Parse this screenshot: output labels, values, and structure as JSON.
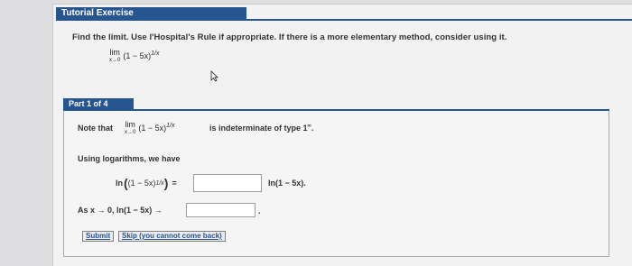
{
  "header": {
    "title": "Tutorial Exercise"
  },
  "question": {
    "text": "Find the limit. Use l'Hospital's Rule if appropriate. If there is a more elementary method, consider using it.",
    "lim_word": "lim",
    "lim_sub": "x→0",
    "expr_base": "(1 − 5x)",
    "expr_exp": "1/x"
  },
  "part": {
    "label": "Part 1 of 4",
    "note_prefix": "Note that",
    "note_suffix": "is indeterminate of type 1",
    "note_sup": "∞",
    "note_period": ".",
    "log_intro": "Using logarithms, we have",
    "ln_prefix": "ln",
    "ln_base": "(1 − 5x)",
    "ln_exp": "1/x",
    "equals": "=",
    "ln_right": "ln(1 − 5x).",
    "as_text": "As x → 0,  ln(1 − 5x) →",
    "as_period": "."
  },
  "buttons": {
    "submit": "Submit",
    "skip": "Skip (you cannot come back)"
  },
  "colors": {
    "accent": "#27558f"
  }
}
